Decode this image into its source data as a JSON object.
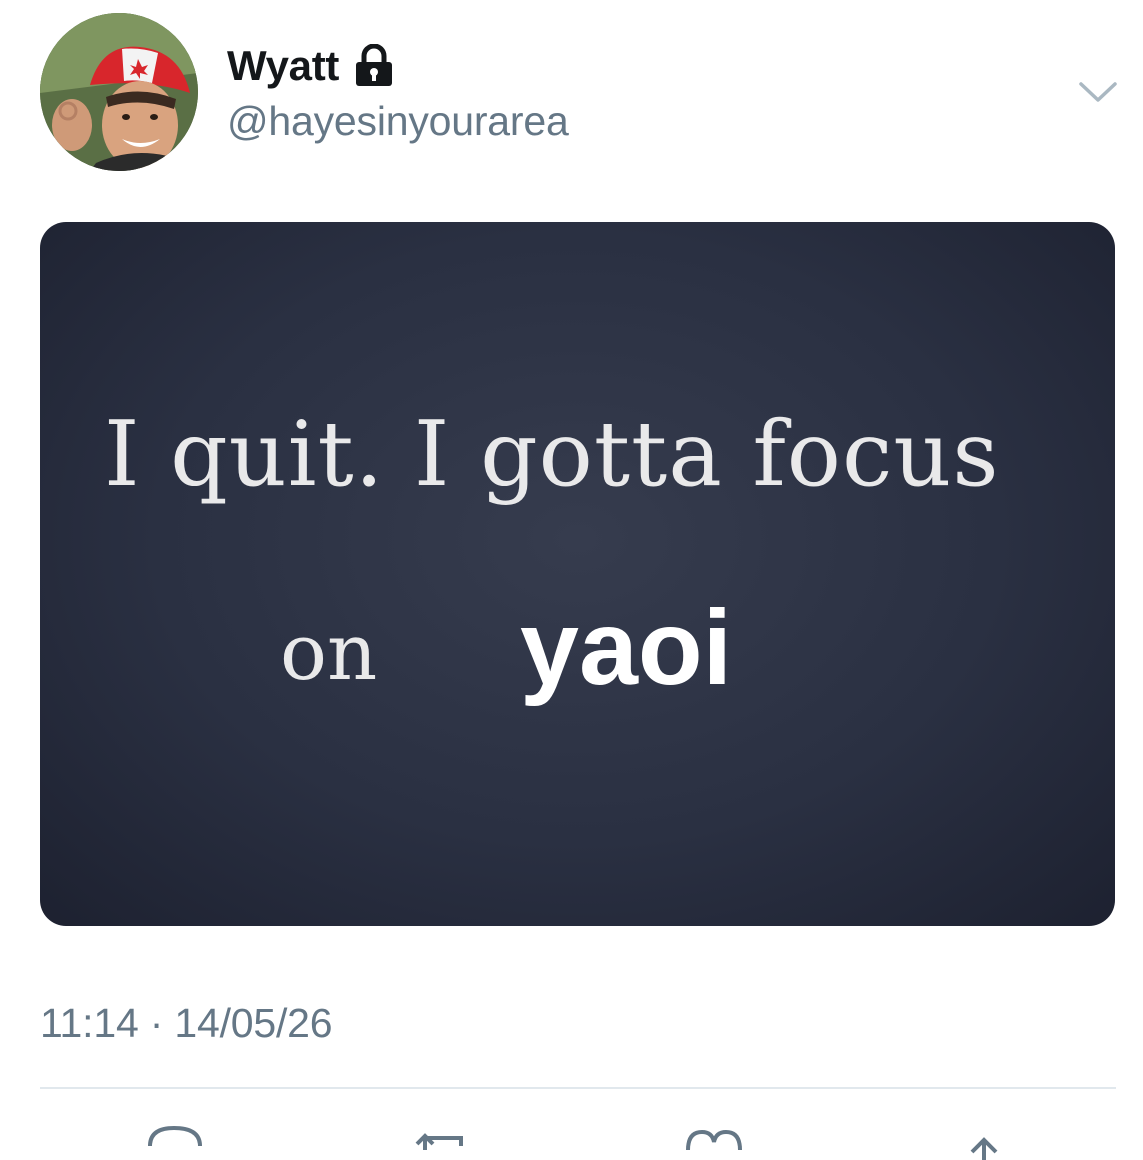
{
  "tweet": {
    "display_name": "Wyatt",
    "handle": "@hayesinyourarea",
    "timestamp": "11:14 · 14/05/26",
    "media_text": {
      "line1": "I quit. I gotta focus",
      "line2": "on",
      "line2_emphasis": "yaoi"
    },
    "icons": {
      "lock": "lock-icon",
      "caret": "chevron-down-icon",
      "reply": "reply-icon",
      "retweet": "retweet-icon",
      "like": "heart-icon",
      "share": "share-icon"
    },
    "colors": {
      "name": "#14171a",
      "secondary_text": "#657786",
      "divider": "#e1e8ed",
      "media_bg": "#2a3042",
      "icon": "#657786"
    }
  }
}
